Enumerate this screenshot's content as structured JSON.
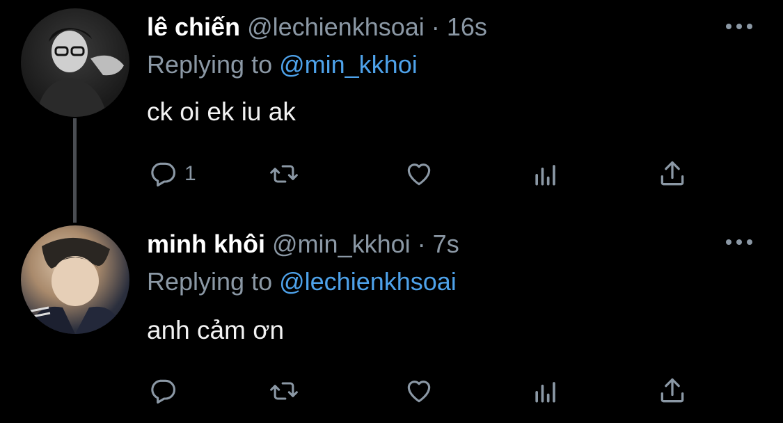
{
  "tweets": [
    {
      "name": "lê chiến",
      "handle": "@lechienkhsoai",
      "separator": "·",
      "time": "16s",
      "replying_prefix": "Replying to ",
      "replying_to": "@min_kkhoi",
      "text": "ck oi ek iu ak",
      "reply_count": "1"
    },
    {
      "name": "minh khôi",
      "handle": "@min_kkhoi",
      "separator": "·",
      "time": "7s",
      "replying_prefix": "Replying to ",
      "replying_to": "@lechienkhsoai",
      "text": "anh cảm ơn",
      "reply_count": ""
    }
  ],
  "icons": {
    "reply": "reply-icon",
    "retweet": "retweet-icon",
    "like": "heart-icon",
    "stats": "stats-icon",
    "share": "share-icon",
    "more": "more-icon"
  },
  "colors": {
    "background": "#000000",
    "secondary_text": "#8b98a5",
    "link": "#4ea2ea",
    "thread_line": "#4a4d52"
  }
}
